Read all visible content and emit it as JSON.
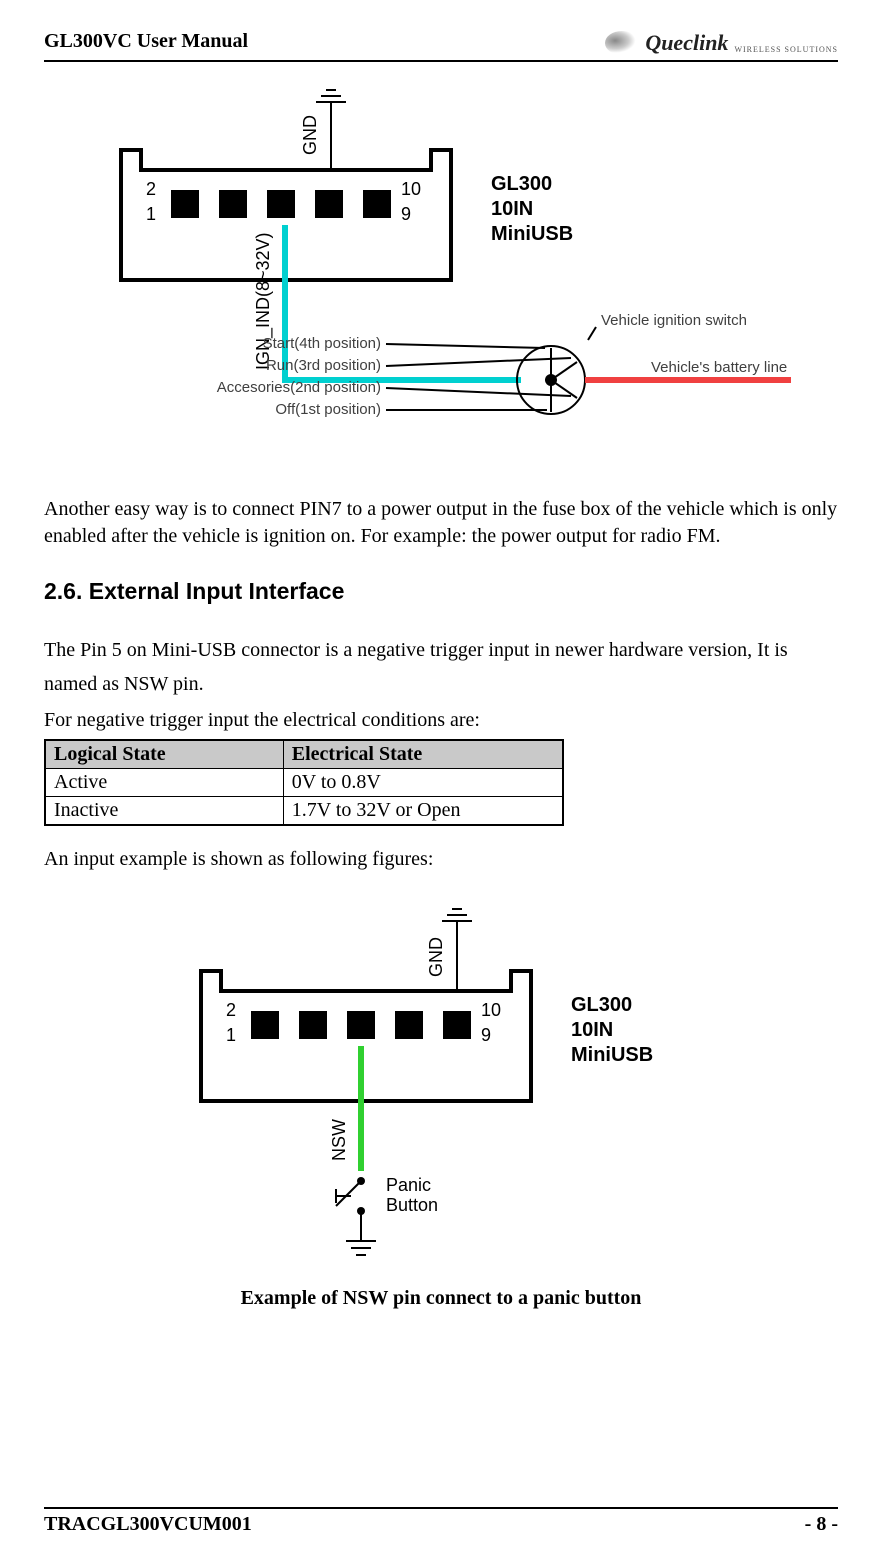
{
  "header": {
    "title": "GL300VC User Manual",
    "logo_name": "Queclink",
    "logo_sub": "WIRELESS SOLUTIONS"
  },
  "diagram1": {
    "pin2": "2",
    "pin1": "1",
    "pin10": "10",
    "pin9": "9",
    "gnd": "GND",
    "ign": "IGN_IND(8~32V)",
    "device_line1": "GL300",
    "device_line2": "10IN",
    "device_line3": "MiniUSB",
    "ignition_switch": "Vehicle ignition switch",
    "pos4": "Start(4th position)",
    "pos3": "Run(3rd position)",
    "pos2": "Accesories(2nd position)",
    "pos1": "Off(1st position)",
    "battery_line": "Vehicle's battery line"
  },
  "para1": "Another easy way is to connect PIN7 to a power output in the fuse box of the vehicle which is only enabled after the vehicle is ignition on. For example: the power output for radio FM.",
  "section_heading": "2.6. External Input Interface",
  "para2": "The Pin 5 on Mini-USB connector is a negative trigger input in newer hardware version, It is named as NSW pin.",
  "para3": "For negative trigger input the electrical conditions are:",
  "table": {
    "header": {
      "col1": "Logical State",
      "col2": "Electrical State"
    },
    "rows": [
      {
        "col1": "Active",
        "col2": "0V to 0.8V"
      },
      {
        "col1": "Inactive",
        "col2": "1.7V to 32V or Open"
      }
    ]
  },
  "para4": "An input example is shown as following figures:",
  "diagram2": {
    "pin2": "2",
    "pin1": "1",
    "pin10": "10",
    "pin9": "9",
    "gnd": "GND",
    "nsw": "NSW",
    "device_line1": "GL300",
    "device_line2": "10IN",
    "device_line3": "MiniUSB",
    "panic_line1": "Panic",
    "panic_line2": "Button"
  },
  "caption": "Example of NSW pin connect to a panic button",
  "footer": {
    "left": "TRACGL300VCUM001",
    "right": "- 8 -"
  }
}
